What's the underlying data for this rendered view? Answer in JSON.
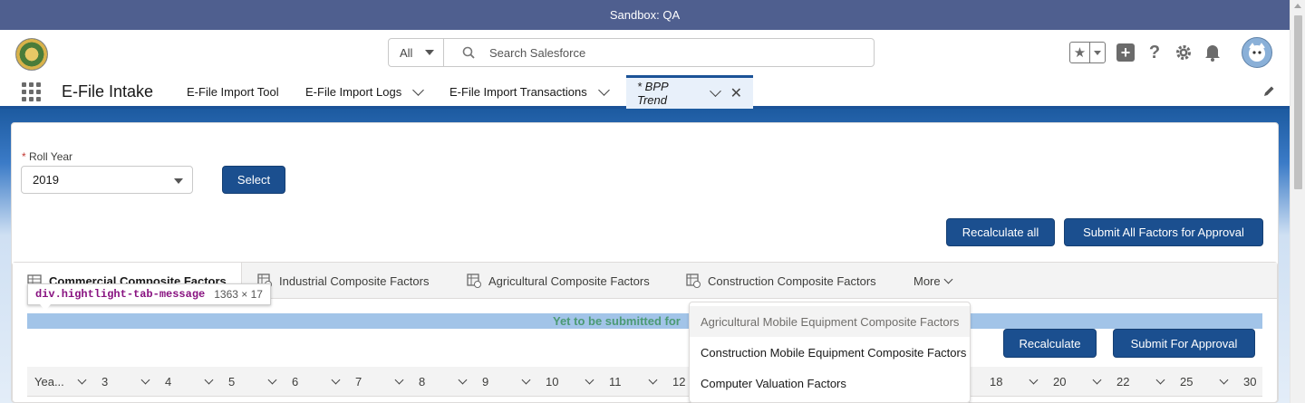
{
  "sandbox": {
    "label": "Sandbox: QA"
  },
  "search": {
    "scope": "All",
    "placeholder": "Search Salesforce"
  },
  "nav": {
    "app_name": "E-File Intake",
    "items": [
      {
        "label": "E-File Import Tool"
      },
      {
        "label": "E-File Import Logs"
      },
      {
        "label": "E-File Import Transactions"
      },
      {
        "label": "* BPP Trend"
      }
    ]
  },
  "form": {
    "roll_year_label": "Roll Year",
    "required_mark": "*",
    "roll_year_value": "2019",
    "select_button": "Select",
    "recalculate_all_button": "Recalculate all",
    "submit_all_button": "Submit All Factors for Approval"
  },
  "tabs": [
    {
      "label": "Commercial Composite Factors"
    },
    {
      "label": "Industrial Composite Factors"
    },
    {
      "label": "Agricultural Composite Factors"
    },
    {
      "label": "Construction Composite Factors"
    }
  ],
  "more_label": "More",
  "tooltip": {
    "name": "div.hightlight-tab-message",
    "size": "1363 × 17"
  },
  "message": {
    "text": "Yet to be submitted for"
  },
  "menu_items": [
    "Agricultural Mobile Equipment Composite Factors",
    "Construction Mobile Equipment Composite Factors",
    "Computer Valuation Factors"
  ],
  "actions": {
    "recalculate": "Recalculate",
    "submit_for_approval": "Submit For Approval"
  },
  "table_headers": [
    "Yea...",
    "3",
    "4",
    "5",
    "6",
    "7",
    "8",
    "9",
    "10",
    "11",
    "12",
    "18",
    "20",
    "22",
    "25",
    "30"
  ],
  "colors": {
    "brand": "#1b4f8f",
    "sandbox_bar": "#4f5f8f",
    "message_bar": "#a2c4e8",
    "message_text": "#4b9a74"
  }
}
